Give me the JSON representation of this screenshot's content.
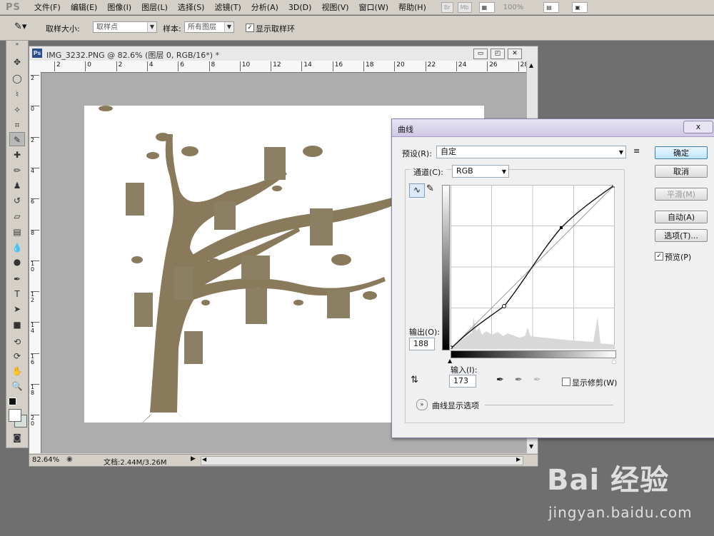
{
  "app": {
    "logo": "PS"
  },
  "menu": [
    "文件(F)",
    "编辑(E)",
    "图像(I)",
    "图层(L)",
    "选择(S)",
    "滤镜(T)",
    "分析(A)",
    "3D(D)",
    "视图(V)",
    "窗口(W)",
    "帮助(H)"
  ],
  "menubar_extras": {
    "br_label": "Br",
    "mb_label": "Mb",
    "zoom": "100%"
  },
  "options": {
    "sample_size_label": "取样大小:",
    "sample_size_value": "取样点",
    "sample_label": "样本:",
    "sample_value": "所有图层",
    "show_ring_label": "显示取样环",
    "show_ring_checked": true
  },
  "document": {
    "title": "IMG_3232.PNG @ 82.6% (图层 0, RGB/16*) *",
    "ruler_h": [
      "2",
      "0",
      "2",
      "4",
      "6",
      "8",
      "10",
      "12",
      "14",
      "16",
      "18",
      "20",
      "22",
      "24",
      "26",
      "28"
    ],
    "ruler_v": [
      "2",
      "0",
      "2",
      "4",
      "6",
      "8",
      "1\n0",
      "1\n2",
      "1\n4",
      "1\n6",
      "1\n8",
      "2\n0"
    ],
    "status_zoom": "82.64%",
    "status_doc": "文档:2.44M/3.26M"
  },
  "curves": {
    "title": "曲线",
    "preset_label": "预设(R):",
    "preset_value": "自定",
    "channel_label": "通道(C):",
    "channel_value": "RGB",
    "output_label": "输出(O):",
    "output_value": "188",
    "input_label": "输入(I):",
    "input_value": "173",
    "show_clipping_label": "显示修剪(W)",
    "curve_options_label": "曲线显示选项",
    "buttons": {
      "ok": "确定",
      "cancel": "取消",
      "smooth": "平滑(M)",
      "auto": "自动(A)",
      "options": "选项(T)..."
    },
    "preview_label": "预览(P)",
    "preview_checked": true,
    "close_glyph": "x"
  },
  "watermark": {
    "logo": "Bai 经验",
    "url": "jingyan.baidu.com"
  },
  "colors": {
    "canvas_art": "#887a5a",
    "dialog_border": "#8a7ea8",
    "default_button": "#3c7fb1"
  }
}
